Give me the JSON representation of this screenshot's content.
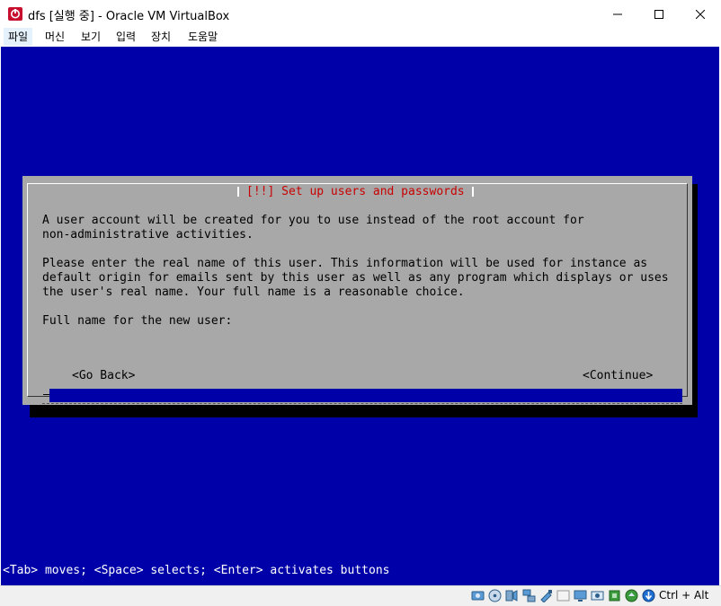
{
  "window": {
    "title": "dfs [실행 중] - Oracle VM VirtualBox",
    "minimize_glyph": "—",
    "maximize_glyph": "☐",
    "close_glyph": "✕"
  },
  "menu": {
    "file": "파일",
    "machine": "머신",
    "view": "보기",
    "input": "입력",
    "devices": "장치",
    "help": "도움말"
  },
  "installer": {
    "dialog_title": "[!!] Set up users and passwords",
    "paragraph1": "A user account will be created for you to use instead of the root account for\nnon-administrative activities.",
    "paragraph2": "Please enter the real name of this user. This information will be used for instance as\ndefault origin for emails sent by this user as well as any program which displays or uses\nthe user's real name. Your full name is a reasonable choice.",
    "field_label": "Full name for the new user:",
    "field_value": "",
    "go_back": "<Go Back>",
    "continue": "<Continue>",
    "help_line": "<Tab> moves; <Space> selects; <Enter> activates buttons"
  },
  "statusbar": {
    "host_key": "Ctrl + Alt",
    "icons": [
      "hard-disk-icon",
      "optical-drive-icon",
      "audio-icon",
      "network-icon",
      "usb-icon",
      "shared-folders-icon",
      "display-icon",
      "video-capture-icon",
      "cpu-activity-icon",
      "mouse-integration-icon",
      "keyboard-capture-icon"
    ]
  },
  "colors": {
    "vm_background": "#0000a8",
    "dialog_background": "#a8a8a8",
    "dialog_title": "#c80000",
    "input_background": "#0000a8"
  }
}
